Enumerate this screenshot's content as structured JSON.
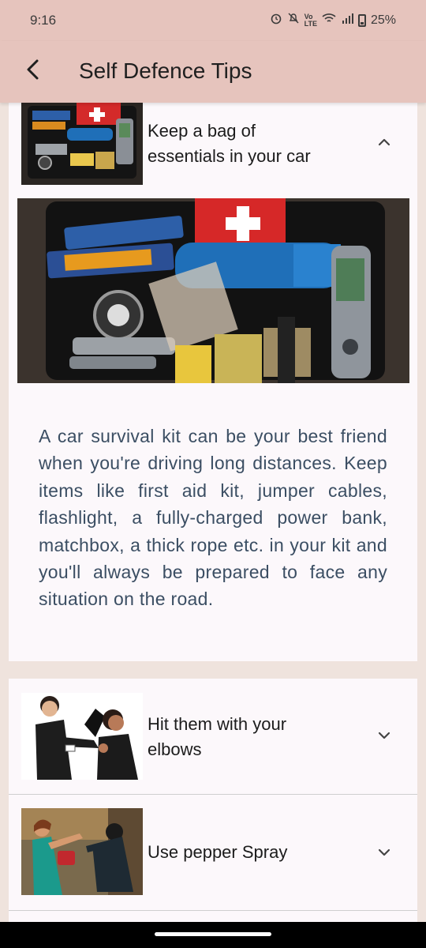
{
  "status_bar": {
    "time": "9:16",
    "battery": "25%",
    "icons": [
      "alarm-icon",
      "mute-icon",
      "volte-icon",
      "wifi-icon",
      "signal-icon",
      "battery-icon"
    ]
  },
  "app_bar": {
    "title": "Self Defence Tips",
    "back_icon": "back-arrow-icon"
  },
  "tips": [
    {
      "title": "Keep a bag of essentials in your car",
      "expanded": true,
      "image": "car-survival-kit-photo",
      "description": "A car survival kit can be your best friend when you're driving long distances. Keep items like first aid kit, jumper cables, flashlight, a fully-charged power bank, matchbox, a thick rope etc. in your kit and you'll always be prepared to face any situation on the road."
    },
    {
      "title": "Hit them with your elbows",
      "expanded": false,
      "image": "elbow-strike-photo"
    },
    {
      "title": "Use pepper Spray",
      "expanded": false,
      "image": "pepper-spray-photo"
    }
  ],
  "colors": {
    "app_bar": "#e6c4bd",
    "background": "#efe3dd",
    "card": "#fcf8fb",
    "description_text": "#3b4e63"
  }
}
